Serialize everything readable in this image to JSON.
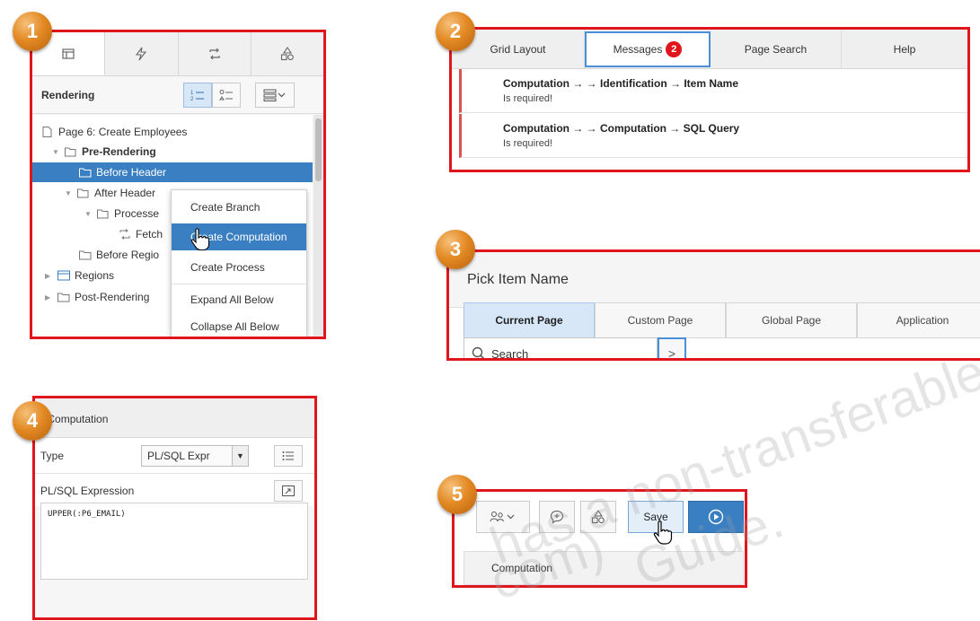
{
  "badges": [
    "1",
    "2",
    "3",
    "4",
    "5"
  ],
  "panel1": {
    "tabs": [
      {
        "icon": "rendering-tree-icon",
        "active": true
      },
      {
        "icon": "lightning-dynamic-actions-icon",
        "active": false
      },
      {
        "icon": "processing-refresh-icon",
        "active": false
      },
      {
        "icon": "shared-components-icon",
        "active": false
      }
    ],
    "toolbar_label": "Rendering",
    "tree": {
      "page": "Page 6: Create Employees",
      "pre_rendering": "Pre-Rendering",
      "before_header": "Before Header",
      "after_header": "After Header",
      "processes": "Processe",
      "fetch": "Fetch",
      "before_regions": "Before Regio",
      "regions": "Regions",
      "post_rendering": "Post-Rendering"
    },
    "context_menu": [
      "Create Branch",
      "Create Computation",
      "Create Process",
      "Expand All Below",
      "Collapse All Below"
    ],
    "context_menu_highlighted": "Create Computation"
  },
  "panel2": {
    "tabs": [
      "Grid Layout",
      "Messages",
      "Page Search",
      "Help"
    ],
    "active_tab": "Messages",
    "message_count": "2",
    "messages": [
      {
        "path": "Computation → → Identification → Item Name",
        "detail": "Is required!"
      },
      {
        "path": "Computation → → Computation → SQL Query",
        "detail": "Is required!"
      }
    ],
    "accent_color": "#e0161c"
  },
  "panel3": {
    "title": "Pick Item Name",
    "tabs": [
      "Current Page",
      "Custom Page",
      "Global Page",
      "Application"
    ],
    "active_tab": "Current Page",
    "search_value": "Search",
    "go_label": ">"
  },
  "panel4": {
    "section": "Computation",
    "type_label": "Type",
    "type_value": "PL/SQL Expr",
    "expression_label": "PL/SQL Expression",
    "expression_value": "UPPER(:P6_EMAIL)"
  },
  "panel5": {
    "save_label": "Save",
    "tab_label": "Computation",
    "run_color": "#3a7fc2"
  },
  "watermark": {
    "line1": "has a non-transferable",
    "line2": "com)",
    "line3": "Guide."
  },
  "colors": {
    "highlight_border": "#e0161c",
    "selection_blue": "#3a7fc2",
    "badge_orange": "#e38a24"
  }
}
